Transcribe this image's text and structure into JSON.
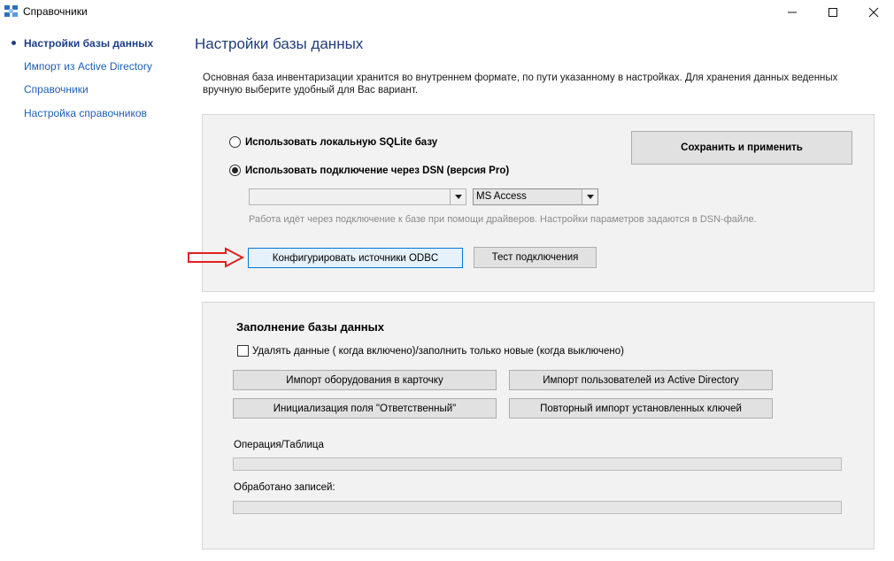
{
  "window": {
    "title": "Справочники"
  },
  "sidebar": {
    "items": [
      {
        "label": "Настройки базы данных",
        "active": true
      },
      {
        "label": "Импорт из Active Directory",
        "active": false
      },
      {
        "label": "Справочники",
        "active": false
      },
      {
        "label": "Настройка справочников",
        "active": false
      }
    ]
  },
  "main": {
    "title": "Настройки базы данных",
    "description": "Основная база инвентаризации хранится во внутреннем формате, по пути указанному в настройках. Для хранения данных веденных вручную выберите удобный для Вас вариант."
  },
  "db_panel": {
    "radio_sqlite": {
      "label": "Использовать локальную SQLite базу",
      "checked": false
    },
    "radio_dsn": {
      "label": "Использовать подключение через DSN (версия Pro)",
      "checked": true
    },
    "save_button": "Сохранить и применить",
    "dsn_select": {
      "value": ""
    },
    "driver_select": {
      "value": "MS Access"
    },
    "hint": "Работа идёт через подключение к базе при помощи драйверов. Настройки параметров задаются в DSN-файле.",
    "odbc_button": "Конфигурировать источники ODBC",
    "test_button": "Тест подключения"
  },
  "fill_panel": {
    "title": "Заполнение базы данных",
    "checkbox": {
      "label": "Удалять данные ( когда включено)/заполнить только новые (когда выключено)",
      "checked": false
    },
    "buttons": {
      "import_equipment": "Импорт оборудования в карточку",
      "import_users": "Импорт пользователей из Active Directory",
      "init_field": "Инициализация поля \"Ответственный\"",
      "reimport_keys": "Повторный импорт установленных ключей"
    },
    "operation_label": "Операция/Таблица",
    "operation_progress": 0,
    "processed_label": "Обработано записей:",
    "processed_progress": 0
  },
  "colors": {
    "link": "#1c5fb8",
    "title": "#1f3d7a",
    "panel_bg": "#f2f2f2",
    "arrow": "#e02020",
    "focus_border": "#0078d7"
  },
  "icons": {
    "app": "app-grid-icon",
    "minimize": "minimize-icon",
    "maximize": "maximize-icon",
    "close": "close-icon",
    "pointer": "red-arrow-icon"
  }
}
